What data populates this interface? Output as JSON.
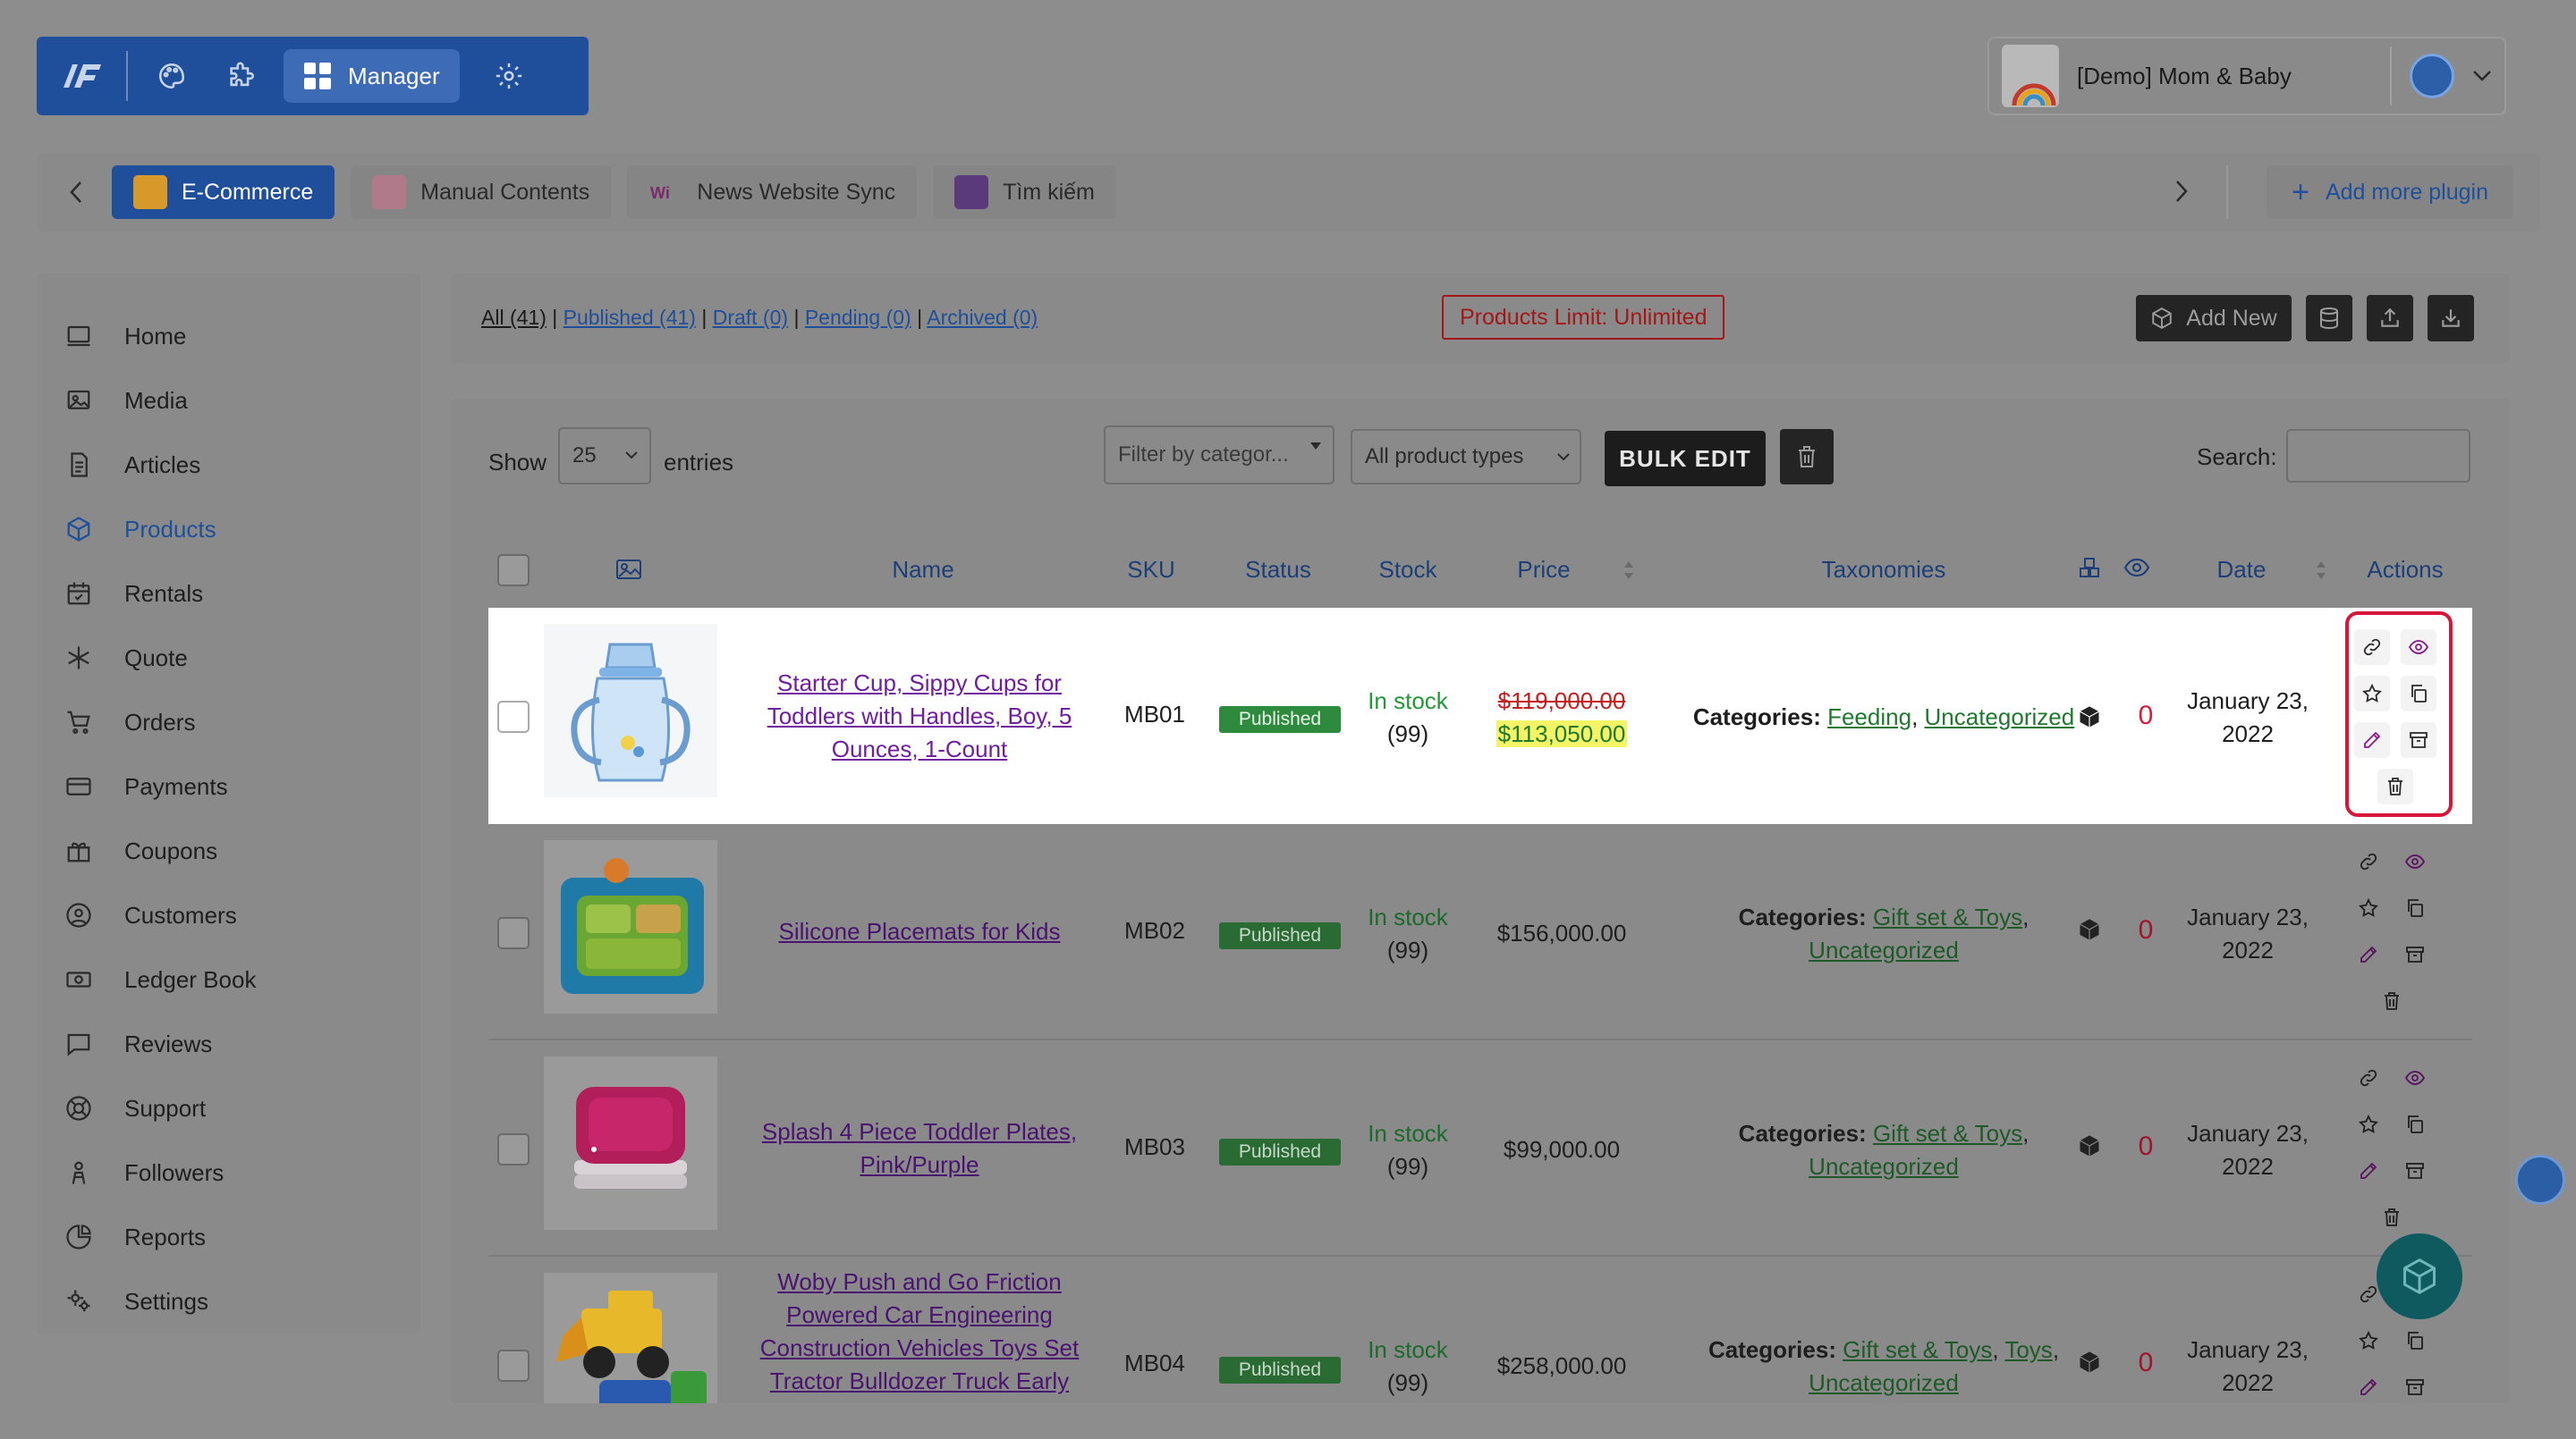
{
  "topnav": {
    "manager_label": "Manager",
    "icons": [
      "logo-icon",
      "palette-icon",
      "puzzle-icon",
      "grid-icon",
      "gear-icon"
    ]
  },
  "store": {
    "name": "[Demo] Mom & Baby"
  },
  "plugins": {
    "tabs": [
      {
        "label": "E-Commerce",
        "active": true
      },
      {
        "label": "Manual Contents",
        "active": false
      },
      {
        "label": "News Website Sync",
        "active": false
      },
      {
        "label": "Tìm kiếm",
        "active": false
      }
    ],
    "add_more_label": "Add more plugin"
  },
  "sidebar": {
    "items": [
      {
        "label": "Home",
        "icon": "monitor-icon"
      },
      {
        "label": "Media",
        "icon": "image-icon"
      },
      {
        "label": "Articles",
        "icon": "document-icon"
      },
      {
        "label": "Products",
        "icon": "box-icon",
        "active": true
      },
      {
        "label": "Rentals",
        "icon": "calendar-icon"
      },
      {
        "label": "Quote",
        "icon": "snowflake-icon"
      },
      {
        "label": "Orders",
        "icon": "cart-icon"
      },
      {
        "label": "Payments",
        "icon": "card-icon"
      },
      {
        "label": "Coupons",
        "icon": "gift-icon"
      },
      {
        "label": "Customers",
        "icon": "user-circle-icon"
      },
      {
        "label": "Ledger Book",
        "icon": "cash-icon"
      },
      {
        "label": "Reviews",
        "icon": "comment-icon"
      },
      {
        "label": "Support",
        "icon": "lifebuoy-icon"
      },
      {
        "label": "Followers",
        "icon": "follower-icon"
      },
      {
        "label": "Reports",
        "icon": "pie-icon"
      },
      {
        "label": "Settings",
        "icon": "cogs-icon"
      }
    ]
  },
  "filters": {
    "all": "All (41)",
    "published": "Published (41)",
    "draft": "Draft (0)",
    "pending": "Pending (0)",
    "archived": "Archived (0)",
    "sep": "|",
    "limit": "Products Limit: Unlimited",
    "add_new": "Add New"
  },
  "controls": {
    "show": "Show",
    "entries_value": "25",
    "entries": "entries",
    "category_placeholder": "Filter by categor...",
    "types_value": "All product types",
    "bulk_edit": "BULK EDIT",
    "search_label": "Search:"
  },
  "columns": {
    "name": "Name",
    "sku": "SKU",
    "status": "Status",
    "stock": "Stock",
    "price": "Price",
    "taxonomies": "Taxonomies",
    "date": "Date",
    "actions": "Actions"
  },
  "products": [
    {
      "name_lines": [
        "Starter Cup, Sippy Cups for",
        "Toddlers with Handles, Boy, 5",
        "Ounces, 1-Count"
      ],
      "sku": "MB01",
      "status": "Published",
      "stock": "In stock",
      "qty": "(99)",
      "price_old": "$119,000.00",
      "price_new": "$113,050.00",
      "tax_label": "Categories:",
      "categories": [
        "Feeding",
        "Uncategorized"
      ],
      "views": "0",
      "date_line1": "January 23,",
      "date_line2": "2022"
    },
    {
      "name_lines": [
        "Silicone Placemats for Kids"
      ],
      "sku": "MB02",
      "status": "Published",
      "stock": "In stock",
      "qty": "(99)",
      "price": "$156,000.00",
      "tax_label": "Categories:",
      "categories": [
        "Gift set & Toys",
        "Uncategorized"
      ],
      "views": "0",
      "date_line1": "January 23,",
      "date_line2": "2022"
    },
    {
      "name_lines": [
        "Splash 4 Piece Toddler Plates,",
        "Pink/Purple"
      ],
      "sku": "MB03",
      "status": "Published",
      "stock": "In stock",
      "qty": "(99)",
      "price": "$99,000.00",
      "tax_label": "Categories:",
      "categories": [
        "Gift set & Toys",
        "Uncategorized"
      ],
      "views": "0",
      "date_line1": "January 23,",
      "date_line2": "2022"
    },
    {
      "name_lines": [
        "Woby Push and Go Friction",
        "Powered Car Engineering",
        "Construction Vehicles Toys Set",
        "Tractor Bulldozer Truck Early"
      ],
      "sku": "MB04",
      "status": "Published",
      "stock": "In stock",
      "qty": "(99)",
      "price": "$258,000.00",
      "tax_label": "Categories:",
      "categories": [
        "Gift set & Toys",
        "Toys",
        "Uncategorized"
      ],
      "views": "0",
      "date_line1": "January 23,",
      "date_line2": "2022"
    }
  ],
  "punct": {
    "comma": ", "
  },
  "colors": {
    "brand": "#1f4f9a",
    "highlight_border": "#d6173a",
    "published": "#2e8b3d",
    "price_old": "#c42020"
  }
}
